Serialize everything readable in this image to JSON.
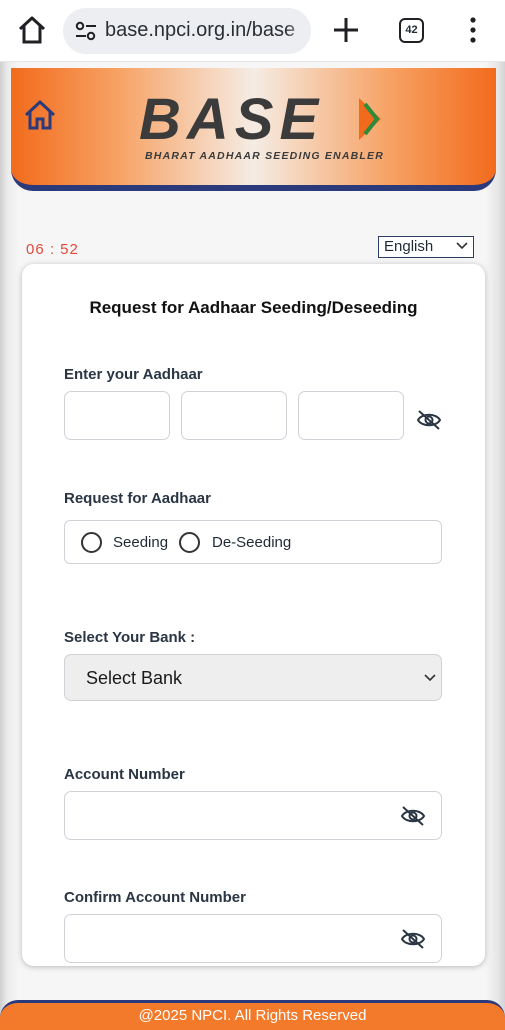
{
  "browser": {
    "url": "base.npci.org.in/base",
    "tab_count": "42",
    "icons": [
      "home-icon",
      "site-settings-icon",
      "plus-icon",
      "tabs-icon",
      "more-vert-icon"
    ]
  },
  "header": {
    "logo_text": "BASE",
    "logo_subtitle": "BHARAT AADHAAR SEEDING ENABLER",
    "colors": {
      "orange": "#f26b1d",
      "navy": "#2b3a7a"
    }
  },
  "timer": "06 : 52",
  "language": {
    "selected": "English"
  },
  "form": {
    "title": "Request for Aadhaar Seeding/Deseeding",
    "aadhaar_label": "Enter your Aadhaar",
    "aadhaar_parts": [
      "",
      "",
      ""
    ],
    "request_label": "Request for Aadhaar",
    "options": [
      "Seeding",
      "De-Seeding"
    ],
    "bank_label": "Select Your Bank :",
    "bank_selected": "Select Bank",
    "account_label": "Account Number",
    "account_value": "",
    "confirm_label": "Confirm Account Number",
    "confirm_value": ""
  },
  "footer": {
    "text": "@2025 NPCI. All Rights Reserved"
  }
}
